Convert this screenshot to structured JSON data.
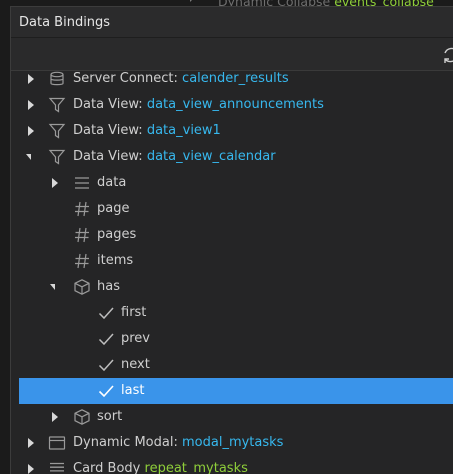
{
  "background": {
    "row_text": "Dynamic Collapse",
    "row_value": "events_collapse"
  },
  "dialog": {
    "title": "Data Bindings"
  },
  "tree": {
    "server_connect": {
      "label": "Server Connect:",
      "value": "calender_results"
    },
    "dv_announcements": {
      "label": "Data View:",
      "value": "data_view_announcements"
    },
    "dv_1": {
      "label": "Data View:",
      "value": "data_view1"
    },
    "dv_calendar": {
      "label": "Data View:",
      "value": "data_view_calendar"
    },
    "data": "data",
    "page": "page",
    "pages": "pages",
    "items": "items",
    "has": "has",
    "first": "first",
    "prev": "prev",
    "next": "next",
    "last": "last",
    "sort": "sort",
    "modal": {
      "label": "Dynamic Modal:",
      "value": "modal_mytasks"
    },
    "card": {
      "label": "Card Body",
      "value": "repeat_mytasks"
    }
  },
  "colors": {
    "selection": "#3a94ea",
    "binding_value": "#37b8ee",
    "binding_value_green": "#8fcf3a"
  },
  "icons": {
    "server_connect": "database-icon",
    "data_view": "filter-icon",
    "data": "list-icon",
    "number": "hash-icon",
    "object": "cube-icon",
    "boolean": "check-icon",
    "modal": "window-icon",
    "card": "list-icon"
  }
}
